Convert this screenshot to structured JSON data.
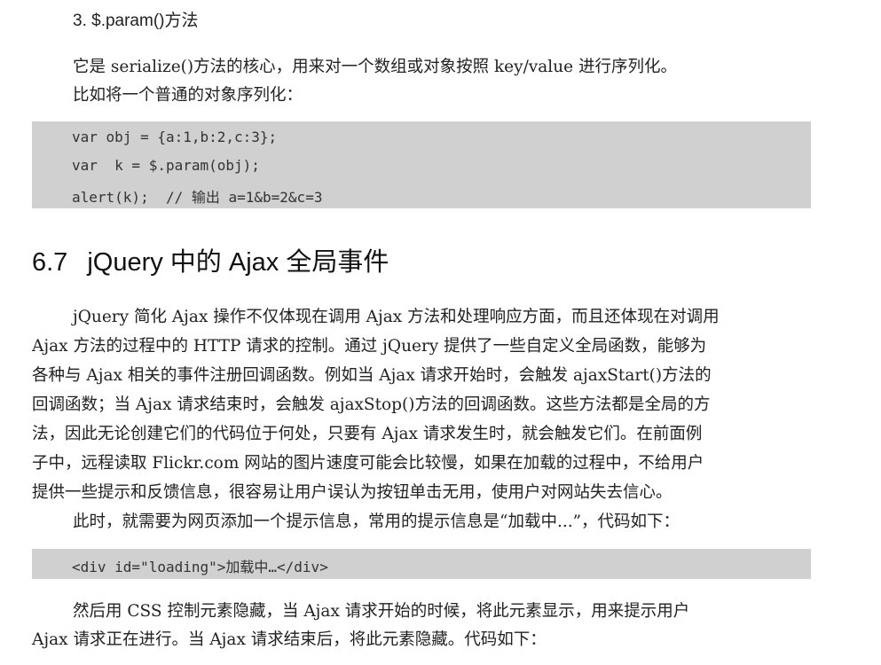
{
  "subsection_title": "3. $.param()方法",
  "intro": {
    "line1": "它是 serialize()方法的核心，用来对一个数组或对象按照 key/value 进行序列化。",
    "line2": "比如将一个普通的对象序列化："
  },
  "code1": [
    "var obj = {a:1,b:2,c:3};",
    "var  k = $.param(obj);",
    "alert(k);  // 输出 a=1&b=2&c=3"
  ],
  "section": {
    "number": "6.7",
    "title": "jQuery 中的 Ajax 全局事件"
  },
  "para1": [
    "jQuery 简化 Ajax 操作不仅体现在调用 Ajax 方法和处理响应方面，而且还体现在对调用",
    "Ajax 方法的过程中的 HTTP 请求的控制。通过 jQuery 提供了一些自定义全局函数，能够为",
    "各种与 Ajax 相关的事件注册回调函数。例如当 Ajax 请求开始时，会触发 ajaxStart()方法的",
    "回调函数；当 Ajax 请求结束时，会触发 ajaxStop()方法的回调函数。这些方法都是全局的方",
    "法，因此无论创建它们的代码位于何处，只要有 Ajax 请求发生时，就会触发它们。在前面例",
    "子中，远程读取 Flickr.com 网站的图片速度可能会比较慢，如果在加载的过程中，不给用户",
    "提供一些提示和反馈信息，很容易让用户误认为按钮单击无用，使用户对网站失去信心。"
  ],
  "para2": "此时，就需要为网页添加一个提示信息，常用的提示信息是“加载中...”，代码如下：",
  "code2": "<div id=\"loading\">加载中…</div>",
  "para3": [
    "然后用 CSS 控制元素隐藏，当 Ajax 请求开始的时候，将此元素显示，用来提示用户",
    "Ajax 请求正在进行。当 Ajax 请求结束后，将此元素隐藏。代码如下："
  ]
}
